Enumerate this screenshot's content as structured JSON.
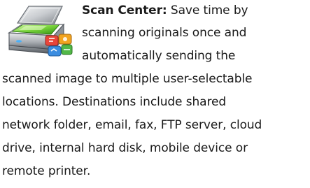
{
  "feature": {
    "icon": "scanner-icon",
    "title": "Scan Center:",
    "lines": [
      "Save time by",
      "scanning originals once and",
      "automatically sending the",
      "scanned image to multiple user-selectable",
      "locations. Destinations include shared",
      "network folder, email, fax, FTP server, cloud",
      "drive, internal hard disk, mobile device or",
      "remote printer."
    ]
  }
}
